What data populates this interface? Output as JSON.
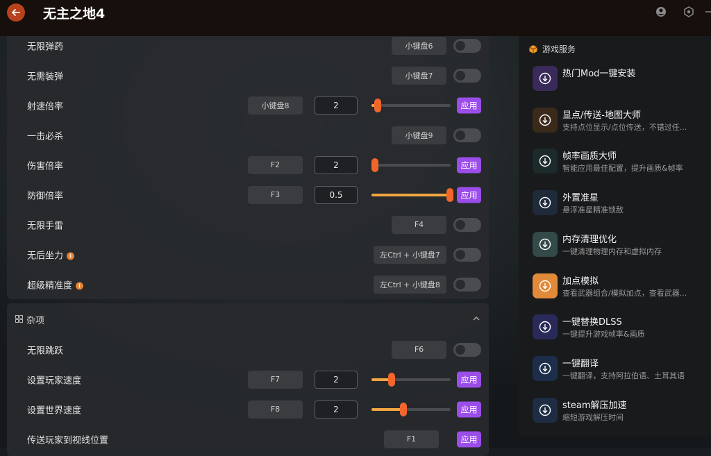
{
  "app": {
    "title": "无主之地4"
  },
  "cheats": [
    {
      "label": "无限弹药",
      "key": "小键盘6",
      "type": "toggle"
    },
    {
      "label": "无需装弹",
      "key": "小键盘7",
      "type": "toggle"
    },
    {
      "label": "射速倍率",
      "key": "小键盘8",
      "type": "slider",
      "value": "2",
      "level": 0.08,
      "apply": "应用"
    },
    {
      "label": "一击必杀",
      "key": "小键盘9",
      "type": "toggle"
    },
    {
      "label": "伤害倍率",
      "key": "F2",
      "type": "slider",
      "value": "2",
      "level": 0.04,
      "apply": "应用"
    },
    {
      "label": "防御倍率",
      "key": "F3",
      "type": "slider",
      "value": "0.5",
      "level": 0.99,
      "apply": "应用"
    },
    {
      "label": "无限手雷",
      "key": "F4",
      "type": "toggle"
    },
    {
      "label": "无后坐力",
      "key": "左Ctrl + 小键盘7",
      "type": "toggle",
      "info": true
    },
    {
      "label": "超级精准度",
      "key": "左Ctrl + 小键盘8",
      "type": "toggle",
      "info": true
    }
  ],
  "misc": {
    "title": "杂项",
    "items": [
      {
        "label": "无限跳跃",
        "key": "F6",
        "type": "toggle"
      },
      {
        "label": "设置玩家速度",
        "key": "F7",
        "type": "slider",
        "value": "2",
        "level": 0.25,
        "apply": "应用"
      },
      {
        "label": "设置世界速度",
        "key": "F8",
        "type": "slider",
        "value": "2",
        "level": 0.4,
        "apply": "应用"
      },
      {
        "label": "传送玩家到视线位置",
        "key": "F1",
        "type": "button",
        "apply": "应用"
      }
    ]
  },
  "services": {
    "title": "游戏服务",
    "items": [
      {
        "name": "热门Mod一键安装",
        "desc": "",
        "color": "#3a2a5a"
      },
      {
        "name": "显点/传送-地图大师",
        "desc": "支持点位显示/点位传送，不错过任...",
        "color": "#3b2a1a"
      },
      {
        "name": "帧率画质大师",
        "desc": "智能应用最佳配置，提升画质&帧率",
        "color": "#1d2a2c"
      },
      {
        "name": "外置准星",
        "desc": "悬浮准星精准锁敌",
        "color": "#1f2a3a"
      },
      {
        "name": "内存清理优化",
        "desc": "一键清理物理内存和虚拟内存",
        "color": "#324a48"
      },
      {
        "name": "加点模拟",
        "desc": "查看武器组合/模拟加点，查看武器...",
        "color": "#e08a3a"
      },
      {
        "name": "一键替换DLSS",
        "desc": "一键提升游戏帧率&画质",
        "color": "#2a2a5a"
      },
      {
        "name": "一键翻译",
        "desc": "一键翻译，支持阿拉伯语、土耳其语",
        "color": "#1d2e4a"
      },
      {
        "name": "steam解压加速",
        "desc": "缩短游戏解压时间",
        "color": "#1e2c44"
      }
    ]
  }
}
